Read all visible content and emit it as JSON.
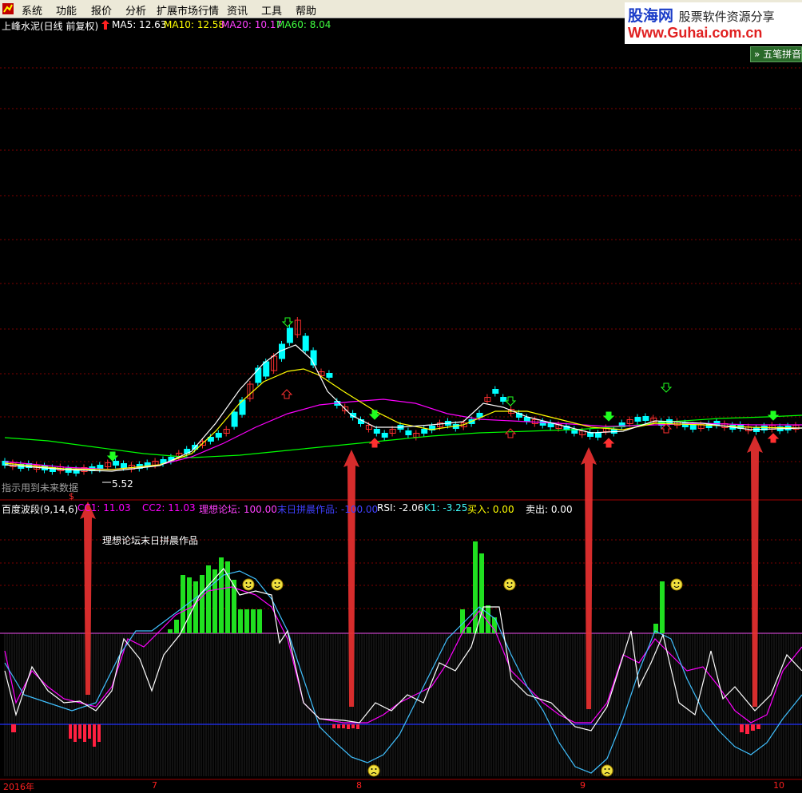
{
  "menu": [
    "系统",
    "功能",
    "报价",
    "分析",
    "扩展市场行情",
    "资讯",
    "工具",
    "帮助"
  ],
  "logo": {
    "top": "股海网",
    "top_rest": "股票软件资源分享",
    "url": "Www.Guhai.com.cn"
  },
  "chart_header": {
    "stock": "上峰水泥(日线 前复权)",
    "ma5": "MA5: 12.63",
    "ma10": "MA10: 12.58",
    "ma20": "MA20: 10.17",
    "ma60": "MA60: 8.04"
  },
  "wubi_button": "五笔拼音",
  "low_price_label": "5.52",
  "future_note": "指示用到未来数据",
  "indicator_header": {
    "name": "百度波段(9,14,6)",
    "cc1": "CC1: 11.03",
    "cc2": "CC2: 11.03",
    "forum": "理想论坛: 100.00",
    "author_val": "末日拼晨作品: -100.00",
    "rsi": "RSI: -2.06",
    "k1": "K1: -3.25",
    "buy": "买入: 0.00",
    "sell": "卖出: 0.00"
  },
  "indicator_note": "理想论坛末日拼晨作品",
  "axis_labels": {
    "year": "2016年",
    "m7": "7",
    "m8": "8",
    "m9": "9",
    "m10": "10"
  },
  "colors": {
    "ma5": "#ffffff",
    "ma10": "#ffff00",
    "ma20": "#ff00ff",
    "ma60": "#00ff00",
    "up": "#ff3030",
    "down": "#00ffff",
    "arrow": "#ff3030",
    "grid": "#800000"
  },
  "chart_data": {
    "type": "candlestick",
    "x_axis": {
      "labels": [
        "2016年",
        "7",
        "8",
        "9",
        "10"
      ]
    },
    "price_low_marker": 5.52,
    "ma_values": {
      "MA5": 12.63,
      "MA10": 12.58,
      "MA20": 10.17,
      "MA60": 8.04
    },
    "indicator": {
      "name": "百度波段(9,14,6)",
      "CC1": 11.03,
      "CC2": 11.03,
      "理想论坛": 100.0,
      "末日拼晨作品": -100.0,
      "RSI": -2.06,
      "K1": -3.25,
      "买入": 0.0,
      "卖出": 0.0
    }
  }
}
